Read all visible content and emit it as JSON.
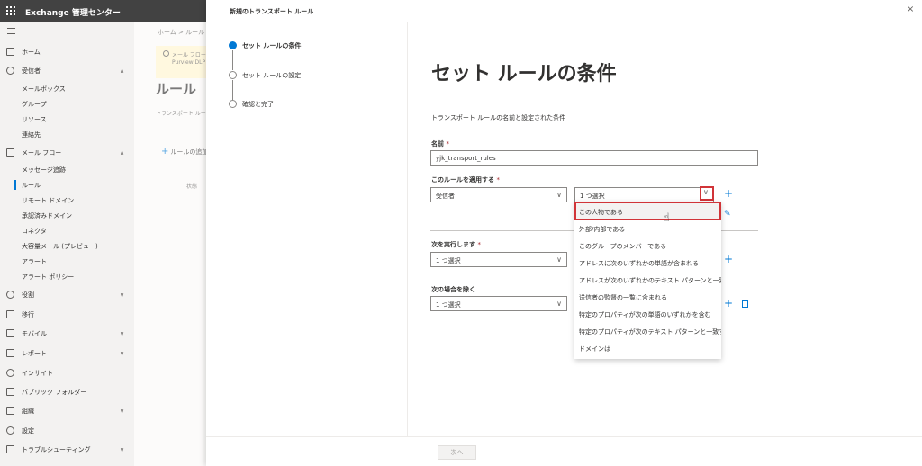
{
  "topbar": {
    "app_title": "Exchange 管理センター"
  },
  "nav": {
    "home": "ホーム",
    "recipients": "受信者",
    "recipients_sub": [
      "メールボックス",
      "グループ",
      "リソース",
      "連絡先"
    ],
    "mail_flow": "メール フロー",
    "mail_flow_sub": [
      "メッセージ追跡",
      "ルール",
      "リモート ドメイン",
      "承認済みドメイン",
      "コネクタ",
      "大容量メール (プレビュー)",
      "アラート",
      "アラート ポリシー"
    ],
    "roles": "役割",
    "migration": "移行",
    "mobile": "モバイル",
    "reports": "レポート",
    "insights": "インサイト",
    "public_folders": "パブリック フォルダー",
    "organization": "組織",
    "settings": "設定",
    "troubleshooting": "トラブルシューティング"
  },
  "background_page": {
    "breadcrumb": "ホーム  >  ルール",
    "banner_line1": "メール フロー ル",
    "banner_line2": "Purview DLP",
    "heading": "ルール",
    "subtitle": "トランスポート ルー",
    "add_rule": "ルールの追加",
    "column": "状態"
  },
  "panel": {
    "title": "新規のトランスポート ルール",
    "close": "×",
    "steps": [
      "セット ルールの条件",
      "セット ルールの設定",
      "確認と完了"
    ],
    "heading": "セット ルールの条件",
    "description": "トランスポート ルールの名前と設定された条件",
    "name_label": "名前",
    "name_value": "yjk_transport_rules",
    "apply_label": "このルールを適用する",
    "apply_select": "受信者",
    "apply_select2": "1 つ選択",
    "do_label": "次を実行します",
    "do_select": "1 つ選択",
    "except_label": "次の場合を除く",
    "except_select": "1 つ選択",
    "required_mark": "*",
    "next_button": "次へ"
  },
  "dropdown": {
    "options": [
      "この人物である",
      "外部/内部である",
      "このグループのメンバーである",
      "アドレスに次のいずれかの単語が含まれる",
      "アドレスが次のいずれかのテキスト パターンと一致する",
      "送信者の監督の一覧に含まれる",
      "特定のプロパティが次の単語のいずれかを含む",
      "特定のプロパティが次のテキスト パターンと一致する",
      "ドメインは"
    ]
  },
  "colors": {
    "accent": "#0078d4",
    "highlight": "#d13438",
    "topbar": "#424242"
  }
}
